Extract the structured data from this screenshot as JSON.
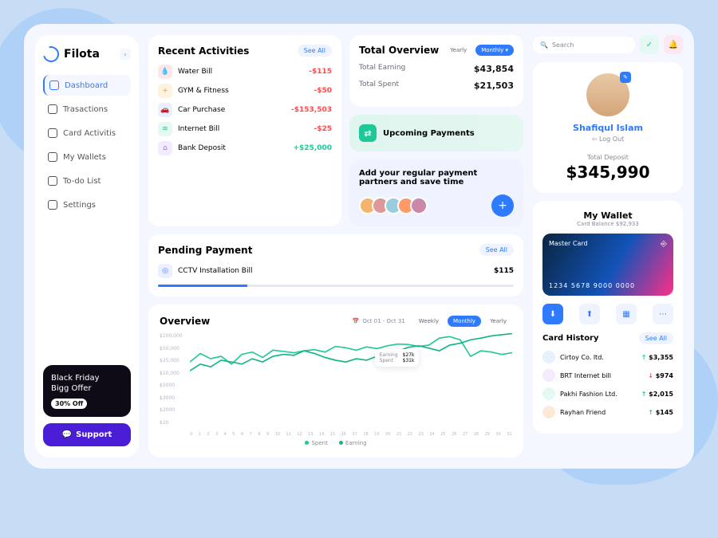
{
  "brand": "Filota",
  "sidebar": {
    "items": [
      {
        "label": "Dashboard",
        "active": true
      },
      {
        "label": "Trasactions"
      },
      {
        "label": "Card Activitis"
      },
      {
        "label": "My Wallets"
      },
      {
        "label": "To-do List"
      },
      {
        "label": "Settings"
      }
    ],
    "promo": {
      "line1": "Black Friday",
      "line2": "Bigg Offer",
      "discount": "30% Off"
    },
    "support_label": "Support"
  },
  "search": {
    "placeholder": "Search"
  },
  "recent": {
    "title": "Recent Activities",
    "see_all": "See All",
    "items": [
      {
        "label": "Water Bill",
        "amount": "-$115",
        "neg": true,
        "bg": "#fde7eb",
        "fg": "#f25a7d",
        "icon": "💧"
      },
      {
        "label": "GYM & Fitness",
        "amount": "-$50",
        "neg": true,
        "bg": "#fff2df",
        "fg": "#f3a23c",
        "icon": "+"
      },
      {
        "label": "Car Purchase",
        "amount": "-$153,503",
        "neg": true,
        "bg": "#eaf0ff",
        "fg": "#5b7dff",
        "icon": "🚗"
      },
      {
        "label": "Internet Bill",
        "amount": "-$25",
        "neg": true,
        "bg": "#e5f8f1",
        "fg": "#1ec997",
        "icon": "≋"
      },
      {
        "label": "Bank Deposit",
        "amount": "+$25,000",
        "neg": false,
        "bg": "#f3ecff",
        "fg": "#9b6af7",
        "icon": "⌂"
      }
    ]
  },
  "pending": {
    "title": "Pending Payment",
    "see_all": "See All",
    "item": {
      "label": "CCTV Installation Bill",
      "amount": "$115",
      "icon": "◎",
      "bg": "#eaf0ff",
      "fg": "#5b7dff"
    }
  },
  "total": {
    "title": "Total Overview",
    "periods": {
      "yearly": "Yearly",
      "monthly": "Monthly ▾"
    },
    "earning_label": "Total Earning",
    "earning": "$43,854",
    "spent_label": "Total Spent",
    "spent": "$21,503"
  },
  "upcoming": {
    "label": "Upcoming Payments"
  },
  "partners": {
    "text": "Add your regular payment partners and save time"
  },
  "overview": {
    "title": "Overview",
    "range": "Oct 01 - Oct 31",
    "periods": {
      "weekly": "Weekly",
      "monthly": "Monthly",
      "yearly": "Yearly"
    },
    "tooltip": {
      "earning_label": "Earning",
      "earning": "$27k",
      "spent_label": "Spent",
      "spent": "$31k"
    },
    "legend": {
      "spent": "Spent",
      "earning": "Earning"
    },
    "y_ticks": [
      "$100,000",
      "$50,000",
      "$25,000",
      "$10,000",
      "$5000",
      "$3000",
      "$2000",
      "$10"
    ]
  },
  "profile": {
    "name": "Shafiqul Islam",
    "logout": "Log Out",
    "deposit_label": "Total Deposit",
    "deposit": "$345,990"
  },
  "wallet": {
    "title": "My Wallet",
    "balance_label": "Card Balance $92,933",
    "card": {
      "brand": "Master Card",
      "number": "1234 5678 9000 0000"
    }
  },
  "history": {
    "title": "Card History",
    "see_all": "See All",
    "items": [
      {
        "label": "Cirtoy Co. ltd.",
        "amount": "$3,355",
        "up": true,
        "bg": "#eaf0ff"
      },
      {
        "label": "BRT Internet bill",
        "amount": "$974",
        "up": false,
        "bg": "#f3ecff"
      },
      {
        "label": "Pakhi Fashion Ltd.",
        "amount": "$2,015",
        "up": true,
        "bg": "#e5f8f1"
      },
      {
        "label": "Rayhan Friend",
        "amount": "$145",
        "up": true,
        "bg": "#fde9d8"
      }
    ]
  },
  "chart_data": {
    "type": "line",
    "title": "Overview",
    "xlabel": "",
    "ylabel": "",
    "x": [
      0,
      1,
      2,
      3,
      4,
      5,
      6,
      7,
      8,
      9,
      10,
      11,
      12,
      13,
      14,
      15,
      16,
      17,
      18,
      19,
      20,
      21,
      22,
      23,
      24,
      25,
      26,
      27,
      28,
      29,
      30,
      31
    ],
    "series": [
      {
        "name": "Spent",
        "color": "#1ec997",
        "values": [
          5000,
          12000,
          7000,
          9000,
          4000,
          11000,
          14000,
          8000,
          17000,
          15000,
          13000,
          16000,
          18000,
          14000,
          25000,
          22000,
          17000,
          24000,
          20000,
          27000,
          32000,
          31000,
          25000,
          29000,
          60000,
          70000,
          50000,
          9000,
          16000,
          14000,
          11000,
          13000
        ]
      },
      {
        "name": "Earning",
        "color": "#0fb587",
        "values": [
          2000,
          4000,
          3000,
          6000,
          5000,
          4000,
          7000,
          5000,
          9000,
          11000,
          10000,
          16000,
          12000,
          8000,
          6000,
          5000,
          7000,
          6000,
          9000,
          11000,
          15000,
          23000,
          27000,
          21000,
          16000,
          29000,
          35000,
          50000,
          60000,
          75000,
          85000,
          95000
        ]
      }
    ],
    "ylim": [
      10,
      100000
    ]
  }
}
